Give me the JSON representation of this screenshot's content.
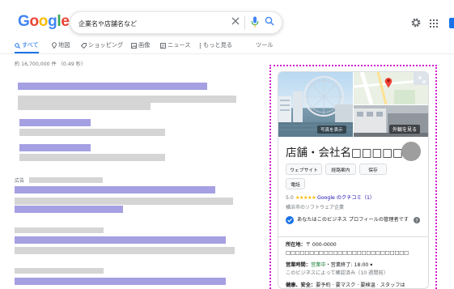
{
  "header": {
    "logo_letters": [
      {
        "ch": "G",
        "color": "#4285f4"
      },
      {
        "ch": "o",
        "color": "#ea4335"
      },
      {
        "ch": "o",
        "color": "#fbbc05"
      },
      {
        "ch": "g",
        "color": "#4285f4"
      },
      {
        "ch": "l",
        "color": "#34a853"
      },
      {
        "ch": "e",
        "color": "#ea4335"
      }
    ],
    "search_placeholder": "企業名や店舗名など"
  },
  "tabs": {
    "all": "すべて",
    "maps": "地図",
    "shopping": "ショッピング",
    "images": "画像",
    "news": "ニュース",
    "more": "もっと見る",
    "tools": "ツール"
  },
  "result_stats": "約 16,700,000 件 （0.49 秒）",
  "ad_label": "広告",
  "knowledge_panel": {
    "photo_button": "写真を表示",
    "street_button": "外観を見る",
    "title": "店舗・会社名□□□□□",
    "buttons": {
      "website": "ウェブサイト",
      "directions": "経路案内",
      "save": "保存",
      "call": "電話"
    },
    "rating_value": "5.0",
    "stars": "★★★★★",
    "reviews_link": "Google のクチコミ（1）",
    "category": "横浜市のソフトウェア企業",
    "verify_text": "あなたはこのビジネス プロフィールの管理者です",
    "address_label": "所在地：",
    "address_value": "〒 000-0000　□□□□□□□□□□□□□□□□□□□□□□□□□□",
    "hours_label": "営業時間：",
    "hours_open": "営業中",
    "hours_close": "・営業終了: 18:00 ▾",
    "hours_note": "このビジネスによって確認済み（10 週間前）",
    "health_label": "健康、安全：",
    "health_value": "要予約 · 要マスク · 要検温 · スタッフは"
  },
  "colors": {
    "accent": "#1a73e8",
    "title_placeholder": "#a5a0e2",
    "text_placeholder": "#d5d5d5",
    "highlight_border": "#d21fcf"
  }
}
